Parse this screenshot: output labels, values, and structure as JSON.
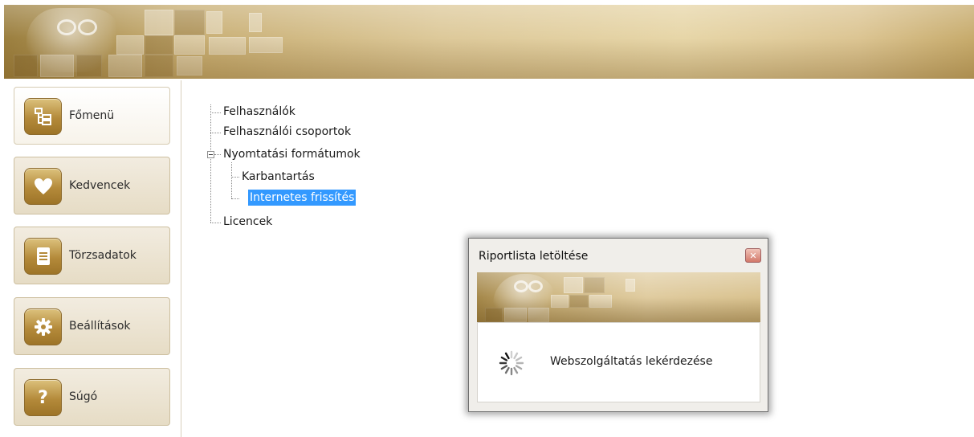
{
  "sidebar": {
    "items": [
      {
        "label": "Főmenü",
        "icon": "tree-icon"
      },
      {
        "label": "Kedvencek",
        "icon": "heart-icon"
      },
      {
        "label": "Törzsadatok",
        "icon": "document-icon"
      },
      {
        "label": "Beállítások",
        "icon": "gear-icon"
      },
      {
        "label": "Súgó",
        "icon": "help-icon"
      }
    ]
  },
  "tree": {
    "items": [
      {
        "label": "Felhasználók"
      },
      {
        "label": "Felhasználói csoportok"
      },
      {
        "label": "Nyomtatási formátumok",
        "expanded": true
      },
      {
        "label": "Karbantartás"
      },
      {
        "label": "Internetes frissítés",
        "selected": true
      },
      {
        "label": "Licencek"
      }
    ]
  },
  "dialog": {
    "title": "Riportlista letöltése",
    "status": "Webszolgáltatás lekérdezése"
  },
  "theme": {
    "accent": "#b48a3a",
    "selection": "#3399ff"
  }
}
